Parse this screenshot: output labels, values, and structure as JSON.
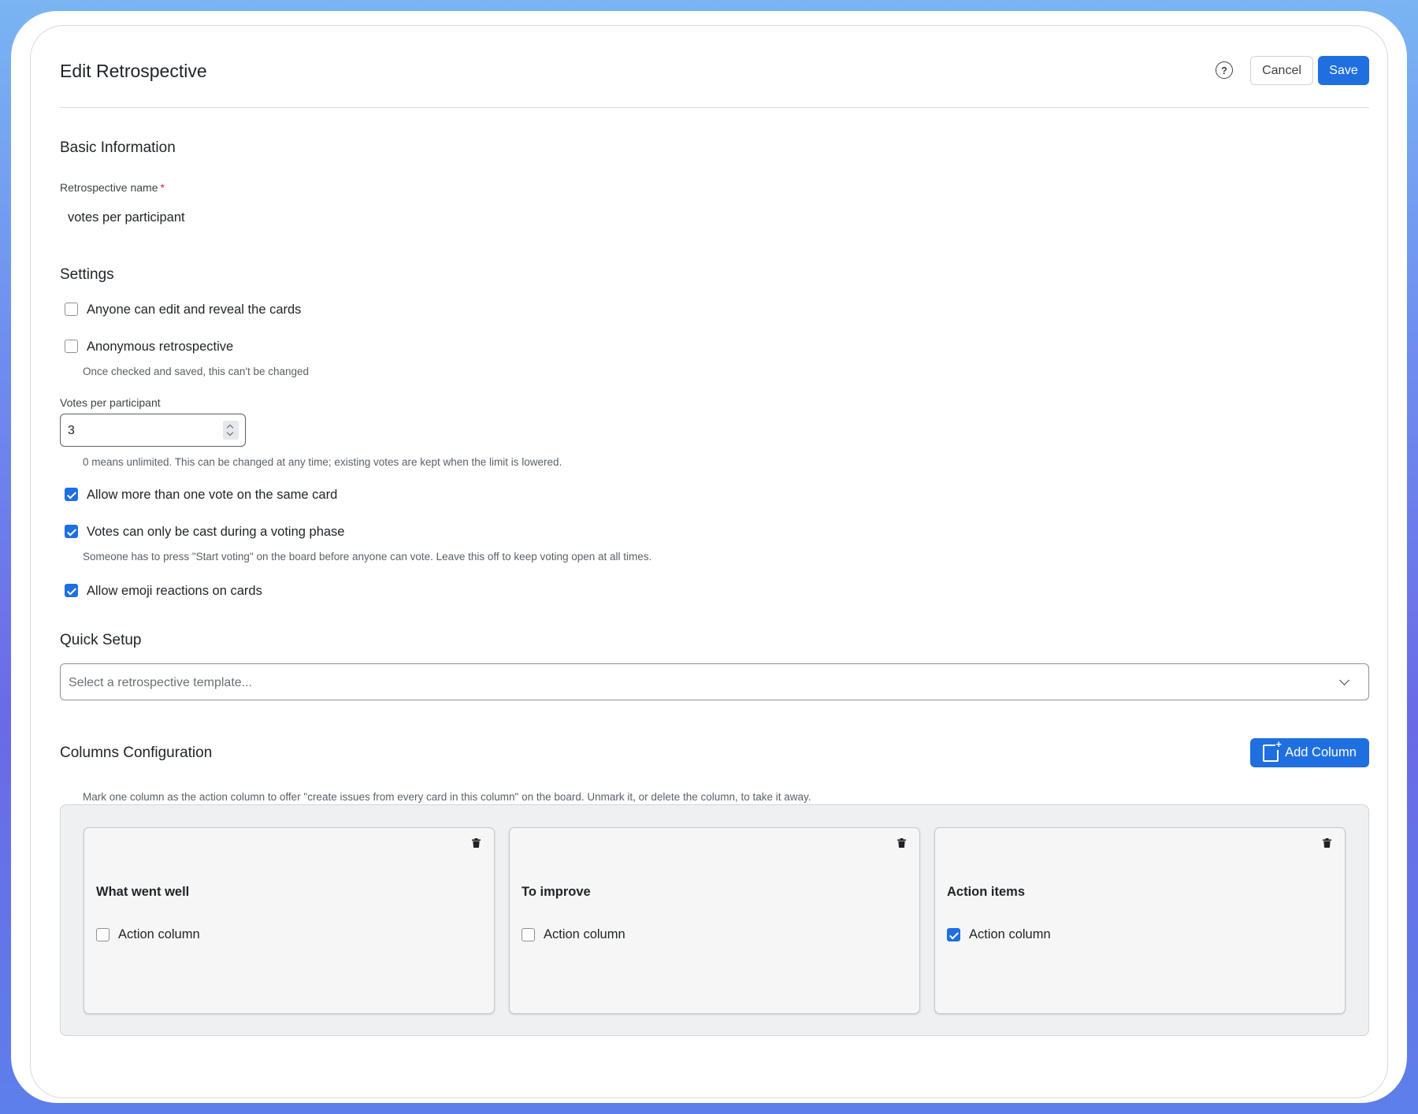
{
  "header": {
    "title": "Edit Retrospective",
    "help_icon": "question-circle-icon",
    "cancel_label": "Cancel",
    "save_label": "Save"
  },
  "basic": {
    "section_title": "Basic Information",
    "name_label": "Retrospective name",
    "required_mark": "*",
    "name_value": "votes per participant"
  },
  "settings": {
    "section_title": "Settings",
    "anyone_edit": {
      "label": "Anyone can edit and reveal the cards",
      "checked": false
    },
    "anonymous": {
      "label": "Anonymous retrospective",
      "checked": false,
      "hint": "Once checked and saved, this can't be changed"
    },
    "votes_label": "Votes per participant",
    "votes_value": "3",
    "votes_hint": "0 means unlimited. This can be changed at any time; existing votes are kept when the limit is lowered.",
    "multi_vote": {
      "label": "Allow more than one vote on the same card",
      "checked": true
    },
    "voting_phase": {
      "label": "Votes can only be cast during a voting phase",
      "checked": true,
      "hint": "Someone has to press \"Start voting\" on the board before anyone can vote. Leave this off to keep voting open at all times."
    },
    "emoji": {
      "label": "Allow emoji reactions on cards",
      "checked": true
    }
  },
  "quick_setup": {
    "section_title": "Quick Setup",
    "template_placeholder": "Select a retrospective template..."
  },
  "columns": {
    "section_title": "Columns Configuration",
    "add_label": "Add Column",
    "hint": "Mark one column as the action column to offer \"create issues from every card in this column\" on the board. Unmark it, or delete the column, to take it away.",
    "action_label": "Action column",
    "items": [
      {
        "title": "What went well",
        "action": false
      },
      {
        "title": "To improve",
        "action": false
      },
      {
        "title": "Action items",
        "action": true
      }
    ]
  },
  "colors": {
    "accent": "#1f6fe0",
    "required": "#d1242f"
  }
}
